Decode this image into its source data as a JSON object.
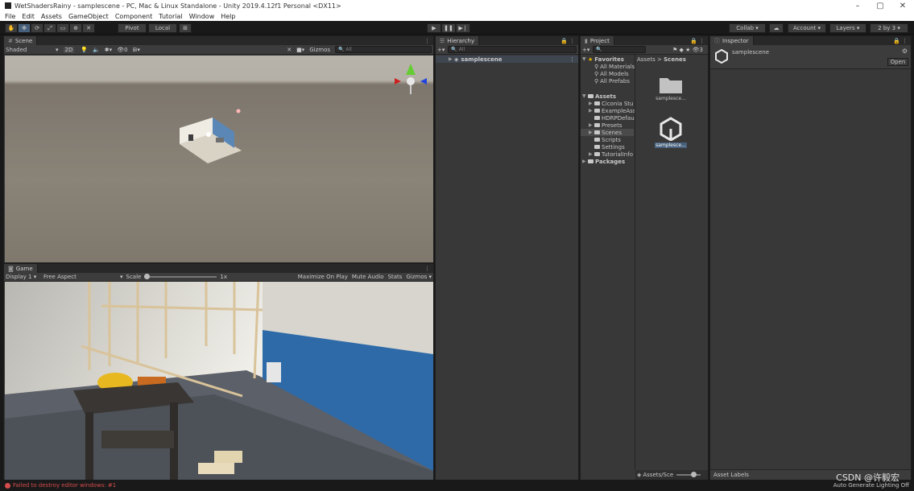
{
  "window": {
    "title": "WetShadersRainy - samplescene - PC, Mac & Linux Standalone - Unity 2019.4.12f1 Personal <DX11>"
  },
  "menu": [
    "File",
    "Edit",
    "Assets",
    "GameObject",
    "Component",
    "Tutorial",
    "Window",
    "Help"
  ],
  "toolbar": {
    "pivot": "Pivot",
    "local": "Local",
    "collab": "Collab",
    "account": "Account",
    "layers": "Layers",
    "layout": "2 by 3"
  },
  "scene": {
    "tab": "Scene",
    "shading": "Shaded",
    "mode2d": "2D",
    "gizmos": "Gizmos",
    "search": "All"
  },
  "game": {
    "tab": "Game",
    "display": "Display 1",
    "aspect": "Free Aspect",
    "scale_label": "Scale",
    "scale_value": "1x",
    "maximize": "Maximize On Play",
    "mute": "Mute Audio",
    "stats": "Stats",
    "gizmos": "Gizmos"
  },
  "hierarchy": {
    "tab": "Hierarchy",
    "add": "+▾",
    "search": "All",
    "root": "samplescene"
  },
  "project": {
    "tab": "Project",
    "favorites": "Favorites",
    "fav_items": [
      "All Materials",
      "All Models",
      "All Prefabs"
    ],
    "assets": "Assets",
    "asset_items": [
      "Ciconia Stu",
      "ExampleAss",
      "HDRPDefau",
      "Presets",
      "Scenes",
      "Scripts",
      "Settings",
      "TutorialInfo"
    ],
    "packages": "Packages",
    "breadcrumb_root": "Assets",
    "breadcrumb_sep": ">",
    "breadcrumb_cur": "Scenes",
    "files": [
      "samplesce...",
      "samplesce..."
    ],
    "footer_path": "Assets/Sce",
    "hidden_count": "3"
  },
  "inspector": {
    "tab": "Inspector",
    "object": "samplescene",
    "open": "Open",
    "labels": "Asset Labels"
  },
  "status": {
    "error": "Failed to destroy editor windows: #1",
    "lighting": "Auto Generate Lighting Off"
  },
  "watermark": "CSDN @许毅宏",
  "colors": {
    "selection": "#46607c",
    "error": "#d54c4c",
    "folder_star": "#e6b800"
  }
}
